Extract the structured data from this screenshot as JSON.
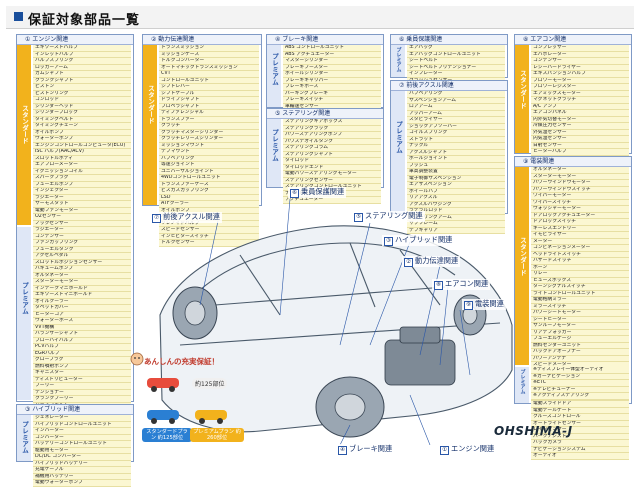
{
  "header": {
    "title": "保証対象部品一覧"
  },
  "sections": {
    "engine": {
      "title": "① エンジン関連",
      "std_label": "スタンダード",
      "std_items": [
        "エキゾーストバルブ",
        "インレットバルブ",
        "バルブスプリング",
        "ロッカーアーム",
        "カムシャフト",
        "クランクシャフト",
        "ピストン",
        "ピストンリング",
        "コンロッド",
        "シリンダーヘッド",
        "シリンダーブロック",
        "タイミングベルト",
        "タイミングチェーン",
        "オイルポンプ",
        "ウォーターポンプ",
        "エンジンコントロールコンピュータ(ECU)",
        "ISC バルブ(AAC/ACV)",
        "スロットルボディ",
        "エアフローメーター",
        "イグニッションコイル",
        "スパークプラグ",
        "フューエルポンプ",
        "インジェクター",
        "ラジエーター",
        "サーモスタット",
        "電動ファンモーター",
        "O2センサー",
        "ノックセンサー",
        "カムポジションセンサー",
        "クランクポジションセンサー",
        "ターボチャージャー",
        "スーパーチャージャー",
        "インタークーラー",
        "エンジンマウント"
      ],
      "prm_label": "プレミアム",
      "prm_items": [
        "ラジエーター",
        "コンデンサー",
        "ファンカップリング",
        "フューエルタンク",
        "アクセルペダル",
        "スロットルポジションセンサー",
        "バキュームポンプ",
        "オルタネーター",
        "スターターモーター",
        "インテークマニホールド",
        "エキゾーストマニホールド",
        "オイルクーラー",
        "タペットカバー",
        "ヒーターコア",
        "ウォーターホース",
        "VVT機構",
        "バランサーシャフト",
        "ブローバイバルブ",
        "PCVバルブ",
        "EGRバルブ",
        "グロープラグ",
        "燃料噴射ポンプ",
        "キャニスター",
        "ディストリビューター",
        "プーリー",
        "テンショナー",
        "クランクプーリー",
        "ドライブベルト"
      ]
    },
    "drive": {
      "title": "② 動力伝達関連",
      "std_label": "スタンダード",
      "std_items": [
        "トランスミッション",
        "ミッションケース",
        "トルクコンバーター",
        "オートマチックトランスミッション",
        "CVT",
        "コントロールユニット",
        "シフトレバー",
        "シフトケーブル",
        "ドライブシャフト",
        "プロペラシャフト",
        "ディファレンシャル",
        "トランスファー",
        "クラッチ",
        "クラッチマスターシリンダー",
        "クラッチレリーズシリンダー",
        "ミッションマウント",
        "デフマウント",
        "ハブベアリング",
        "等速ジョイント",
        "ユニバーサルジョイント",
        "4WDコントロールユニット",
        "トランスファーケース",
        "ビスカスカップリング",
        "LSD",
        "ATFクーラー",
        "オイルポンプ",
        "バルブボディ",
        "ソレノイドバルブ",
        "スピードセンサー",
        "インヒビタースイッチ",
        "トルクセンサー"
      ]
    },
    "brake": {
      "title": "④ ブレーキ関連",
      "prm_label": "プレミアム",
      "prm_items": [
        "ABS コントロールユニット",
        "ABS アクチュエーター",
        "マスターシリンダー",
        "ブレーキブースター",
        "ホイールシリンダー",
        "ブレーキキャリパー",
        "ブレーキホース",
        "パーキングブレーキ",
        "ブレーキスイッチ",
        "車輪速センサー",
        "ブレーキペダル"
      ]
    },
    "steering": {
      "title": "⑤ ステアリング関連",
      "prm_label": "プレミアム",
      "prm_items": [
        "ステアリングギアボックス",
        "ステアリングラック",
        "パワーステアリングポンプ",
        "パワステオイルタンク",
        "ステアリングコラム",
        "ステアリングシャフト",
        "タイロッド",
        "タイロッドエンド",
        "電動パワーステアリングモーター",
        "ステアリングセンサー",
        "ステアリングコントロールユニット",
        "ナックルアーム",
        "アクチュエーター"
      ]
    },
    "occupant": {
      "title": "⑥ 乗員保護関連",
      "prm_label": "プレミアム",
      "prm_items": [
        "エアバッグ",
        "エアバッグコントロールユニット",
        "シートベルト",
        "シートベルトプリテンショナー",
        "インフレーター",
        "クラッシュセンサー"
      ]
    },
    "rear_axle": {
      "title": "⑦ 前後アクスル関連",
      "prm_label": "プレミアム",
      "prm_items": [
        "ハブベアリング",
        "サスペンションアーム",
        "ロアアーム",
        "アッパーアーム",
        "スタビライザー",
        "ショックアブソーバー",
        "コイルスプリング",
        "ストラット",
        "ナックル",
        "アクスルシャフト",
        "ボールジョイント",
        "ブッシュ",
        "車高調整装置",
        "電子制御サスペンション",
        "エアサスペンション",
        "ホイールハブ",
        "リアアクスル",
        "アクスルハウジング",
        "ラテラルロッド",
        "トレーリングアーム",
        "サブフレーム",
        "デフキャリア"
      ]
    },
    "aircon": {
      "title": "⑧ エアコン関連",
      "std_label": "スタンダード",
      "std_items": [
        "コンプレッサー",
        "エバポレーター",
        "コンデンサー",
        "レシーバードライヤー",
        "エキスパンションバルブ",
        "ブロワーモーター",
        "ブロワーレジスター",
        "エアミックスモーター",
        "マグネットクラッチ",
        "A/C アンプ",
        "エアコンパネル",
        "内外気切替モーター",
        "冷媒圧力センサー",
        "外気温センサー",
        "内気温センサー",
        "日射センサー",
        "ヒーターバルブ",
        "エアコンユニット",
        "エアコンコントロールユニット"
      ]
    },
    "electric": {
      "title": "⑨ 電装関連",
      "std_label": "スタンダード",
      "std_items": [
        "オルタネーター",
        "スターターモーター",
        "パワーウインドウモーター",
        "パワーウインドウスイッチ",
        "ワイパーモーター",
        "ワイパースイッチ",
        "ウォッシャーモーター",
        "ドアロックアクチュエーター",
        "ドアロックスイッチ",
        "キーレスエントリー",
        "イモビライザー",
        "メーター",
        "コンビネーションメーター",
        "ヘッドライトスイッチ",
        "ハザードスイッチ",
        "ホーン",
        "リレー",
        "ヒューズボックス",
        "ターンシグナルスイッチ",
        "ライトコントロールユニット",
        "電動格納ミラー",
        "ミラースイッチ",
        "パワーシートモーター",
        "シートヒーター",
        "サンルーフモーター",
        "リアデフォッガー",
        "フューエルゲージ",
        "燃料センダーユニット",
        "バックドアオープナー",
        "パワーアンテナ",
        "スピードメーター",
        "タコメーター",
        "水温計",
        "油圧計",
        "時計",
        "車速センサー",
        "電動スライドドア",
        "電動テールゲート",
        "クルーズコントロール",
        "オートライトセンサー",
        "レインセンサー",
        "パークアシスト",
        "バックカメラ",
        "ナビゲーションシステム",
        "オーディオ"
      ],
      "prm_label": "プレミアム",
      "prm_items": [
        "※ディスプレイ一体型オーディオ",
        "※カーナビゲーション",
        "※ETC",
        "※テレビチューナー",
        "※アクティブステアリング"
      ]
    },
    "hybrid": {
      "title": "③ ハイブリッド関連",
      "prm_label": "プレミアム",
      "prm_items": [
        "ジェネレーター",
        "ハイブリッドコントロールユニット",
        "インバーター",
        "コンバーター",
        "バッテリーコントロールユニット",
        "駆動用モーター",
        "DC/DC コンバーター",
        "ハイブリッドバッテリー",
        "充電ケーブル",
        "補機用バッテリー",
        "電動ウォーターポンプ"
      ]
    }
  },
  "car_labels": [
    {
      "num": "⑦",
      "text": "前後アクスル関連"
    },
    {
      "num": "⑥",
      "text": "乗員保護関連"
    },
    {
      "num": "⑤",
      "text": "ステアリング関連"
    },
    {
      "num": "③",
      "text": "ハイブリッド関連"
    },
    {
      "num": "②",
      "text": "動力伝達関連"
    },
    {
      "num": "⑧",
      "text": "エアコン関連"
    },
    {
      "num": "⑨",
      "text": "電装関連"
    },
    {
      "num": "④",
      "text": "ブレーキ関連"
    },
    {
      "num": "①",
      "text": "エンジン関連"
    }
  ],
  "promo": {
    "title": "あんしんの充実保証！",
    "bubble1": "約125部位",
    "std_plan": "スタンダードプラン 約125部位",
    "prm_plan": "プレミアムプラン 約260部位"
  },
  "logo": "OHSHIMA-J"
}
